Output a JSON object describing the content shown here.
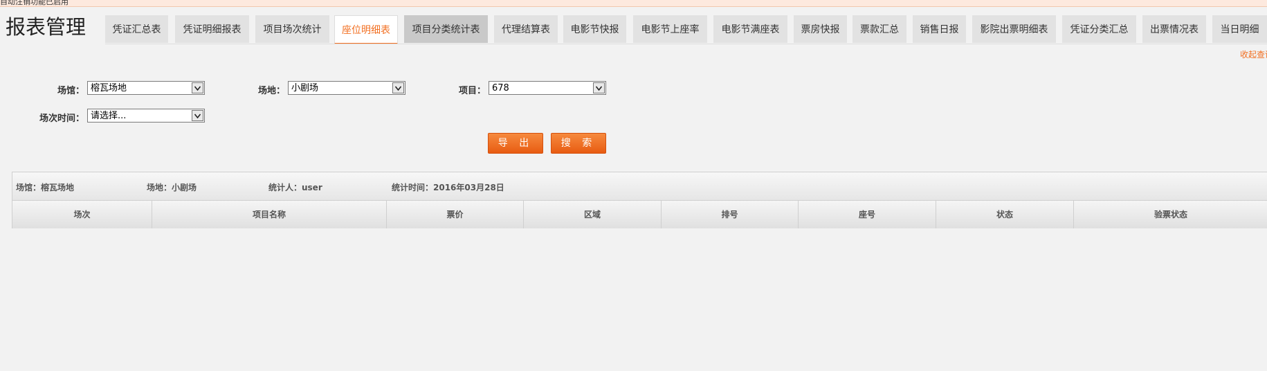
{
  "top_banner": "自动注销功能已启用",
  "page_title": "报表管理",
  "tabs": [
    {
      "label": "凭证汇总表",
      "state": "normal"
    },
    {
      "label": "凭证明细报表",
      "state": "normal"
    },
    {
      "label": "项目场次统计",
      "state": "normal"
    },
    {
      "label": "座位明细表",
      "state": "active"
    },
    {
      "label": "项目分类统计表",
      "state": "hover"
    },
    {
      "label": "代理结算表",
      "state": "normal"
    },
    {
      "label": "电影节快报",
      "state": "normal"
    },
    {
      "label": "电影节上座率",
      "state": "normal"
    },
    {
      "label": "电影节满座表",
      "state": "normal"
    },
    {
      "label": "票房快报",
      "state": "normal"
    },
    {
      "label": "票款汇总",
      "state": "normal"
    },
    {
      "label": "销售日报",
      "state": "normal"
    },
    {
      "label": "影院出票明细表",
      "state": "normal"
    },
    {
      "label": "凭证分类汇总",
      "state": "normal"
    },
    {
      "label": "出票情况表",
      "state": "normal"
    },
    {
      "label": "当日明细",
      "state": "normal"
    }
  ],
  "collapse_link": "收起查询",
  "filters": {
    "venue": {
      "label": "场馆：",
      "value": "榕瓦场地"
    },
    "site": {
      "label": "场地：",
      "value": "小剧场"
    },
    "project": {
      "label": "项目：",
      "value": "678"
    },
    "session_time": {
      "label": "场次时间：",
      "value": "请选择..."
    }
  },
  "buttons": {
    "export": "导 出",
    "search": "搜 索"
  },
  "report_info": {
    "venue": "场馆：榕瓦场地",
    "site": "场地：小剧场",
    "statistician": "统计人：user",
    "stat_time": "统计时间：2016年03月28日"
  },
  "table_headers": [
    "场次",
    "项目名称",
    "票价",
    "区域",
    "排号",
    "座号",
    "状态",
    "验票状态"
  ],
  "colors": {
    "accent": "#f26f21",
    "button": "#ee6f22",
    "background": "#f2f2f2"
  }
}
